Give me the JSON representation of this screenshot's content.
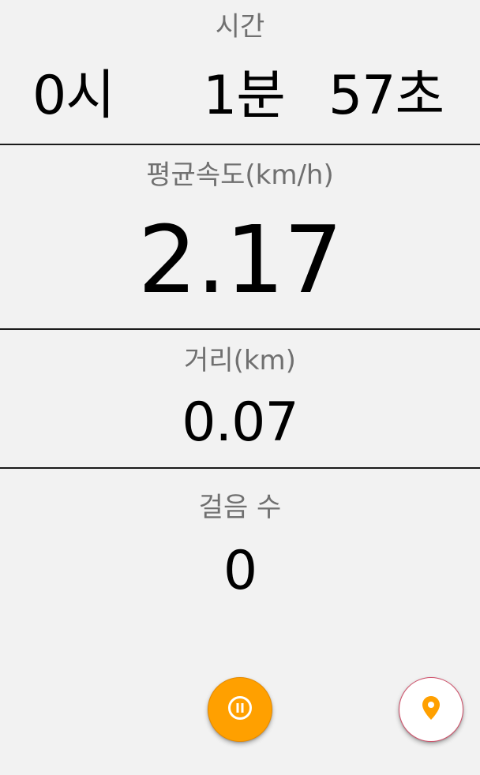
{
  "time": {
    "label": "시간",
    "hours": "0시",
    "minutes": "1분",
    "seconds": "57초"
  },
  "avg_speed": {
    "label": "평균속도(km/h)",
    "value": "2.17"
  },
  "distance": {
    "label": "거리(km)",
    "value": "0.07"
  },
  "steps": {
    "label": "걸음 수",
    "value": "0"
  },
  "buttons": {
    "pause_icon": "pause-circle-icon",
    "location_icon": "location-pin-icon"
  },
  "colors": {
    "background": "#f2f2f2",
    "label": "#707070",
    "value": "#000000",
    "divider": "#1a1a1a",
    "accent": "#ffa000"
  }
}
